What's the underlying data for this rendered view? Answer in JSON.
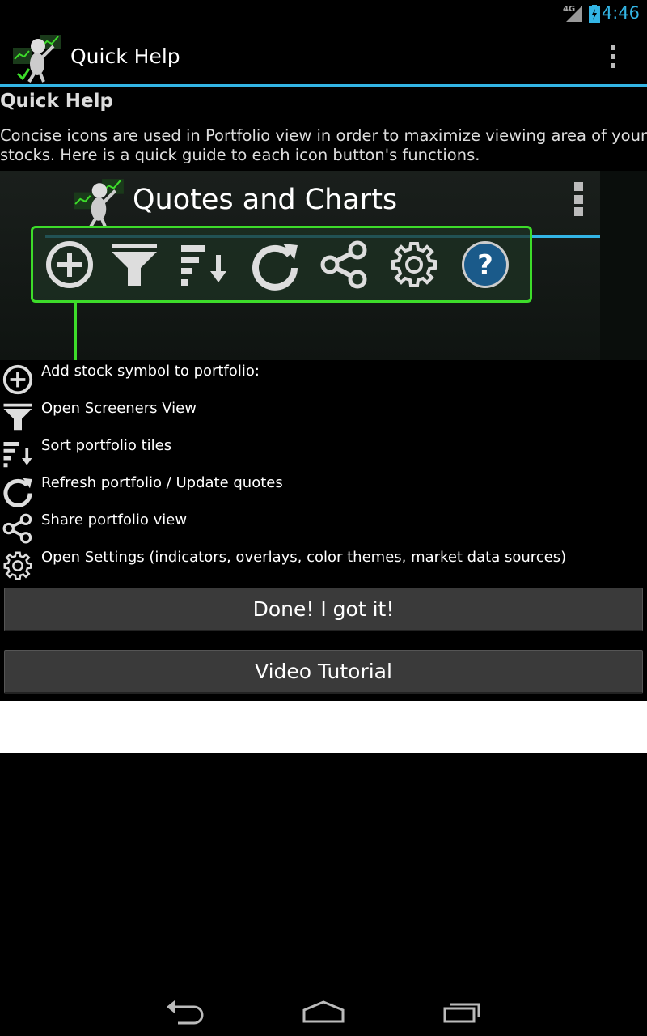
{
  "status_bar": {
    "network": "4G",
    "time": "4:46"
  },
  "action_bar": {
    "title": "Quick Help",
    "logo_icon": "app-logo-figure-icon",
    "menu_icon": "overflow-menu-icon"
  },
  "content": {
    "section_title": "Quick Help",
    "description": "Concise icons are used in Portfolio view in order to maximize viewing area of your stocks. Here is a quick guide to each icon button's functions."
  },
  "preview": {
    "title": "Quotes and Charts",
    "toolbar_icons": [
      "add-icon",
      "filter-icon",
      "sort-icon",
      "refresh-icon",
      "share-icon",
      "settings-icon",
      "help-icon"
    ],
    "highlight_color": "#3ddc2a",
    "accent_color": "#33b5e5"
  },
  "legend": [
    {
      "icon": "add-icon",
      "label": "Add stock symbol to portfolio:"
    },
    {
      "icon": "filter-icon",
      "label": "Open Screeners View"
    },
    {
      "icon": "sort-icon",
      "label": "Sort portfolio tiles"
    },
    {
      "icon": "refresh-icon",
      "label": "Refresh portfolio / Update quotes"
    },
    {
      "icon": "share-icon",
      "label": "Share portfolio view"
    },
    {
      "icon": "settings-icon",
      "label": "Open Settings (indicators, overlays, color themes, market data sources)"
    }
  ],
  "buttons": {
    "done": "Done! I got it!",
    "video": "Video Tutorial"
  },
  "nav_bar": {
    "back_icon": "back-icon",
    "home_icon": "home-icon",
    "recents_icon": "recents-icon"
  }
}
